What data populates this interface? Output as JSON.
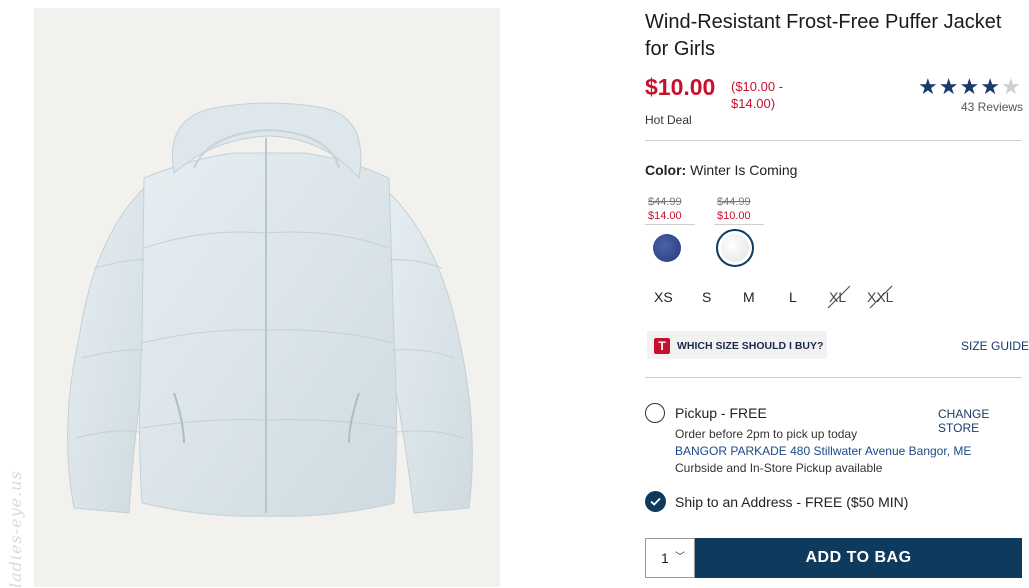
{
  "product": {
    "title": "Wind-Resistant Frost-Free Puffer Jacket for Girls",
    "price": "$10.00",
    "price_range": "($10.00 - $14.00)",
    "badge": "Hot Deal",
    "rating": 4,
    "rating_max": 5,
    "reviews": "43 Reviews"
  },
  "image": {
    "watermark": "ladies-eye.us"
  },
  "color": {
    "label": "Color:",
    "value": "Winter Is Coming",
    "swatches": [
      {
        "name": "navy",
        "was": "$44.99",
        "now": "$14.00",
        "hex": "#2f4388"
      },
      {
        "name": "winter-is-coming",
        "was": "$44.99",
        "now": "$10.00",
        "hex": "#f0f0ee",
        "selected": true
      }
    ]
  },
  "sizes": [
    {
      "label": "XS",
      "available": true
    },
    {
      "label": "S",
      "available": true
    },
    {
      "label": "M",
      "available": true
    },
    {
      "label": "L",
      "available": true
    },
    {
      "label": "XL",
      "available": false
    },
    {
      "label": "XXL",
      "available": false
    }
  ],
  "size_help": {
    "icon_letter": "T",
    "which_size": "WHICH SIZE SHOULD I BUY?",
    "size_guide": "SIZE GUIDE"
  },
  "fulfillment": {
    "pickup": {
      "label": "Pickup - FREE",
      "change_store": "CHANGE STORE",
      "order_by": "Order before 2pm to pick up today",
      "store": "BANGOR PARKADE 480 Stillwater Avenue  Bangor, ME",
      "note": "Curbside and In-Store Pickup available",
      "selected": false
    },
    "ship": {
      "label": "Ship to an Address - FREE ($50 MIN)",
      "selected": true
    }
  },
  "bag": {
    "quantity": "1",
    "add_label": "ADD TO BAG"
  },
  "colors": {
    "sale_red": "#c8102e",
    "navy": "#0e3a5e",
    "link_blue": "#1a3a6b"
  }
}
